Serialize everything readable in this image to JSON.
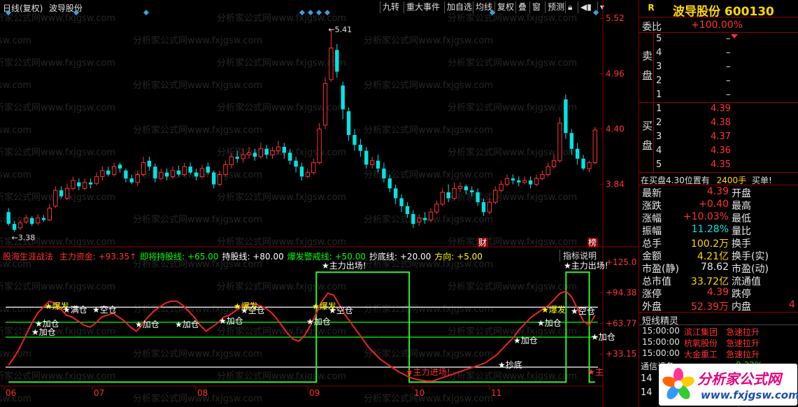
{
  "header": {
    "period": "日线(复权)",
    "stock_name": "波导股份",
    "buttons": [
      "九转",
      "重大事件",
      "加自选",
      "均线",
      "复权",
      "叠",
      "窗",
      "预测"
    ]
  },
  "main_chart": {
    "price_labels": [
      "5.52",
      "4.96",
      "4.40",
      "3.84"
    ],
    "high_annotation": "5.41",
    "low_annotation": "3.38",
    "events": [
      "财",
      "榜"
    ],
    "candles": [
      [
        3.56,
        3.44,
        3.6,
        3.42
      ],
      [
        3.44,
        3.38,
        3.47,
        3.36
      ],
      [
        3.4,
        3.45,
        3.48,
        3.38
      ],
      [
        3.46,
        3.5,
        3.53,
        3.44
      ],
      [
        3.5,
        3.44,
        3.52,
        3.42
      ],
      [
        3.45,
        3.5,
        3.54,
        3.43
      ],
      [
        3.5,
        3.48,
        3.53,
        3.46
      ],
      [
        3.48,
        3.6,
        3.64,
        3.47
      ],
      [
        3.62,
        3.78,
        3.82,
        3.6
      ],
      [
        3.78,
        3.72,
        3.82,
        3.7
      ],
      [
        3.7,
        3.8,
        3.85,
        3.68
      ],
      [
        3.8,
        3.88,
        3.92,
        3.78
      ],
      [
        3.86,
        3.82,
        3.9,
        3.78
      ],
      [
        3.8,
        3.86,
        3.9,
        3.78
      ],
      [
        3.86,
        3.84,
        3.9,
        3.8
      ],
      [
        3.85,
        3.92,
        3.96,
        3.83
      ],
      [
        3.92,
        3.98,
        4.02,
        3.88
      ],
      [
        3.98,
        3.94,
        4.02,
        3.92
      ],
      [
        3.94,
        4.02,
        4.06,
        3.92
      ],
      [
        4.04,
        4.0,
        4.06,
        3.96
      ],
      [
        3.98,
        3.9,
        4.0,
        3.86
      ],
      [
        3.9,
        3.86,
        3.94,
        3.84
      ],
      [
        3.86,
        3.94,
        3.98,
        3.82
      ],
      [
        3.94,
        4.06,
        4.12,
        3.92
      ],
      [
        4.08,
        4.02,
        4.12,
        3.98
      ],
      [
        4.02,
        3.9,
        4.05,
        3.86
      ],
      [
        3.9,
        3.96,
        4.0,
        3.88
      ],
      [
        3.96,
        3.92,
        4.0,
        3.88
      ],
      [
        3.92,
        3.98,
        4.02,
        3.9
      ],
      [
        3.98,
        3.94,
        4.03,
        3.92
      ],
      [
        3.94,
        4.02,
        4.06,
        3.92
      ],
      [
        4.02,
        3.96,
        4.06,
        3.94
      ],
      [
        3.96,
        3.92,
        4.0,
        3.88
      ],
      [
        3.92,
        4.0,
        4.04,
        3.9
      ],
      [
        4.02,
        3.96,
        4.06,
        3.94
      ],
      [
        3.96,
        3.84,
        3.98,
        3.8
      ],
      [
        3.84,
        3.94,
        3.98,
        3.82
      ],
      [
        3.94,
        4.04,
        4.08,
        3.92
      ],
      [
        4.04,
        4.12,
        4.16,
        4.0
      ],
      [
        4.12,
        4.1,
        4.18,
        4.06
      ],
      [
        4.1,
        4.14,
        4.2,
        4.06
      ],
      [
        4.14,
        4.16,
        4.22,
        4.1
      ],
      [
        4.16,
        4.12,
        4.2,
        4.08
      ],
      [
        4.12,
        4.2,
        4.26,
        4.1
      ],
      [
        4.2,
        4.14,
        4.24,
        4.1
      ],
      [
        4.14,
        4.18,
        4.22,
        4.1
      ],
      [
        4.18,
        4.22,
        4.28,
        4.14
      ],
      [
        4.22,
        4.16,
        4.26,
        4.1
      ],
      [
        4.16,
        4.08,
        4.2,
        4.04
      ],
      [
        4.08,
        4.02,
        4.12,
        3.96
      ],
      [
        4.02,
        3.92,
        4.06,
        3.88
      ],
      [
        3.92,
        3.96,
        4.0,
        3.9
      ],
      [
        3.96,
        4.06,
        4.1,
        3.94
      ],
      [
        4.06,
        4.4,
        4.46,
        4.04
      ],
      [
        4.44,
        4.86,
        4.92,
        4.4
      ],
      [
        4.9,
        5.22,
        5.41,
        4.88
      ],
      [
        5.2,
        4.98,
        5.26,
        4.92
      ],
      [
        4.84,
        4.6,
        4.88,
        4.5
      ],
      [
        4.58,
        4.34,
        4.62,
        4.28
      ],
      [
        4.34,
        4.24,
        4.4,
        4.18
      ],
      [
        4.24,
        4.18,
        4.3,
        4.12
      ],
      [
        4.18,
        4.04,
        4.22,
        4.0
      ],
      [
        4.04,
        4.08,
        4.12,
        4.0
      ],
      [
        4.08,
        4.0,
        4.14,
        3.96
      ],
      [
        4.0,
        3.9,
        4.06,
        3.86
      ],
      [
        3.9,
        3.8,
        3.94,
        3.76
      ],
      [
        3.8,
        3.7,
        3.84,
        3.64
      ],
      [
        3.7,
        3.62,
        3.74,
        3.56
      ],
      [
        3.62,
        3.54,
        3.66,
        3.5
      ],
      [
        3.54,
        3.44,
        3.58,
        3.4
      ],
      [
        3.46,
        3.5,
        3.54,
        3.42
      ],
      [
        3.5,
        3.48,
        3.56,
        3.44
      ],
      [
        3.48,
        3.56,
        3.6,
        3.46
      ],
      [
        3.56,
        3.64,
        3.68,
        3.54
      ],
      [
        3.64,
        3.76,
        3.8,
        3.62
      ],
      [
        3.76,
        3.7,
        3.84,
        3.66
      ],
      [
        3.7,
        3.8,
        3.86,
        3.68
      ],
      [
        3.8,
        3.82,
        3.86,
        3.76
      ],
      [
        3.82,
        3.78,
        3.84,
        3.74
      ],
      [
        3.78,
        3.76,
        3.82,
        3.72
      ],
      [
        3.76,
        3.66,
        3.8,
        3.62
      ],
      [
        3.66,
        3.56,
        3.7,
        3.52
      ],
      [
        3.56,
        3.66,
        3.7,
        3.54
      ],
      [
        3.66,
        3.78,
        3.82,
        3.64
      ],
      [
        3.78,
        3.84,
        3.88,
        3.76
      ],
      [
        3.84,
        3.9,
        3.94,
        3.82
      ],
      [
        3.9,
        3.88,
        3.94,
        3.84
      ],
      [
        3.88,
        3.86,
        3.92,
        3.82
      ],
      [
        3.86,
        3.88,
        3.92,
        3.84
      ],
      [
        3.88,
        3.84,
        3.92,
        3.8
      ],
      [
        3.84,
        3.9,
        3.94,
        3.82
      ],
      [
        3.9,
        3.94,
        3.98,
        3.88
      ],
      [
        3.94,
        4.02,
        4.06,
        3.92
      ],
      [
        4.02,
        4.08,
        4.14,
        4.0
      ],
      [
        4.08,
        4.46,
        4.52,
        4.06
      ],
      [
        4.7,
        4.36,
        4.75,
        4.3
      ],
      [
        4.36,
        4.2,
        4.4,
        4.14
      ],
      [
        4.2,
        4.1,
        4.26,
        4.04
      ],
      [
        4.1,
        4.0,
        4.14,
        3.98
      ],
      [
        4.0,
        4.06,
        4.08,
        3.96
      ],
      [
        4.06,
        4.39,
        4.42,
        4.04
      ]
    ]
  },
  "indicator": {
    "name": "股海生涯战法",
    "legend": [
      {
        "label": "主力资金: +93.35↑",
        "color": "#ff3232"
      },
      {
        "label": "即将持股线: +65.00",
        "color": "#00ff00"
      },
      {
        "label": "持股线: +80.00",
        "color": "#ffffff"
      },
      {
        "label": "爆发警戒线: +50.00",
        "color": "#00ff00"
      },
      {
        "label": "抄底线: +20.00",
        "color": "#ffffff"
      },
      {
        "label": "方向: +5.00",
        "color": "#ffff00"
      }
    ],
    "explain_button": "指标说明",
    "y_labels": [
      "+125.0",
      "+94.38",
      "+63.77",
      "+33.15"
    ],
    "labels": {
      "main_exit": "★主力出场!",
      "main_enter": "★主力进场!",
      "add": "★加仓",
      "burst": "★爆发",
      "full": "★满仓",
      "empty": "★空仓",
      "bottom": "★抄底",
      "main_short": "★主"
    },
    "x_ticks": [
      "06",
      "07",
      "08",
      "09",
      "10",
      "11"
    ],
    "capital": [
      22,
      30,
      40,
      52,
      64,
      74,
      80,
      86,
      84,
      78,
      72,
      70,
      66,
      62,
      60,
      64,
      70,
      72,
      74,
      70,
      66,
      60,
      56,
      62,
      70,
      76,
      80,
      84,
      86,
      86,
      82,
      76,
      70,
      62,
      56,
      60,
      64,
      70,
      72,
      76,
      80,
      82,
      84,
      82,
      80,
      76,
      70,
      62,
      54,
      48,
      46,
      52,
      62,
      74,
      86,
      94,
      92,
      82,
      72,
      64,
      56,
      48,
      40,
      34,
      28,
      24,
      20,
      16,
      13,
      10,
      8,
      7,
      6,
      6,
      8,
      10,
      12,
      14,
      16,
      18,
      20,
      22,
      24,
      28,
      32,
      38,
      44,
      50,
      58,
      64,
      70,
      74,
      78,
      82,
      88,
      94,
      96,
      90,
      78,
      66,
      62,
      72
    ]
  },
  "quote": {
    "title": "波导股份 600130",
    "badge": "R",
    "weibi_label": "委比",
    "weibi_value": "+100.00%",
    "sell_label": "卖盘",
    "buy_label": "买盘",
    "sell": [
      [
        "5",
        "–"
      ],
      [
        "4",
        "–"
      ],
      [
        "3",
        "–"
      ],
      [
        "2",
        "–"
      ],
      [
        "1",
        "–"
      ]
    ],
    "buy": [
      [
        "1",
        "4.39"
      ],
      [
        "2",
        "4.38"
      ],
      [
        "3",
        "4.37"
      ],
      [
        "4",
        "4.36"
      ],
      [
        "5",
        "4.35"
      ]
    ],
    "notice": "在买盘4.30位置有",
    "notice_vol": "2400手",
    "notice_tail": "买单!",
    "stats": [
      [
        "最新",
        "4.39",
        "开盘",
        ""
      ],
      [
        "涨跌",
        "+0.40",
        "最高",
        ""
      ],
      [
        "涨幅",
        "+10.03%",
        "最低",
        ""
      ],
      [
        "振幅",
        "11.28%",
        "量比",
        ""
      ],
      [
        "总手",
        "100.2万",
        "换手",
        ""
      ],
      [
        "金额",
        "4.21亿",
        "换手(实)",
        ""
      ],
      [
        "市盈(静)",
        "78.62",
        "市盈(动)",
        ""
      ],
      [
        "总市值",
        "33.72亿",
        "流通值",
        ""
      ],
      [
        "涨停",
        "4.39",
        "跌停",
        ""
      ],
      [
        "外盘",
        "52.39万",
        "内盘",
        "4"
      ]
    ],
    "sprite_title": "短线精灵",
    "sprite_rows": [
      [
        "15:00:00",
        "滨江集团",
        "急速拉升"
      ],
      [
        "15:00:00",
        "杭氧股份",
        "急速拉升"
      ],
      [
        "15:00:00",
        "大金重工",
        "急速拉升"
      ]
    ],
    "cut_row": [
      "通信设备",
      "0.32%"
    ],
    "bottom_rows": [
      "14",
      "14"
    ]
  },
  "watermark": {
    "text": "分析家公式网www.fxjgsw.com",
    "logo_title": "分析家公式网",
    "logo_url": "www.fxjgsw.com"
  }
}
